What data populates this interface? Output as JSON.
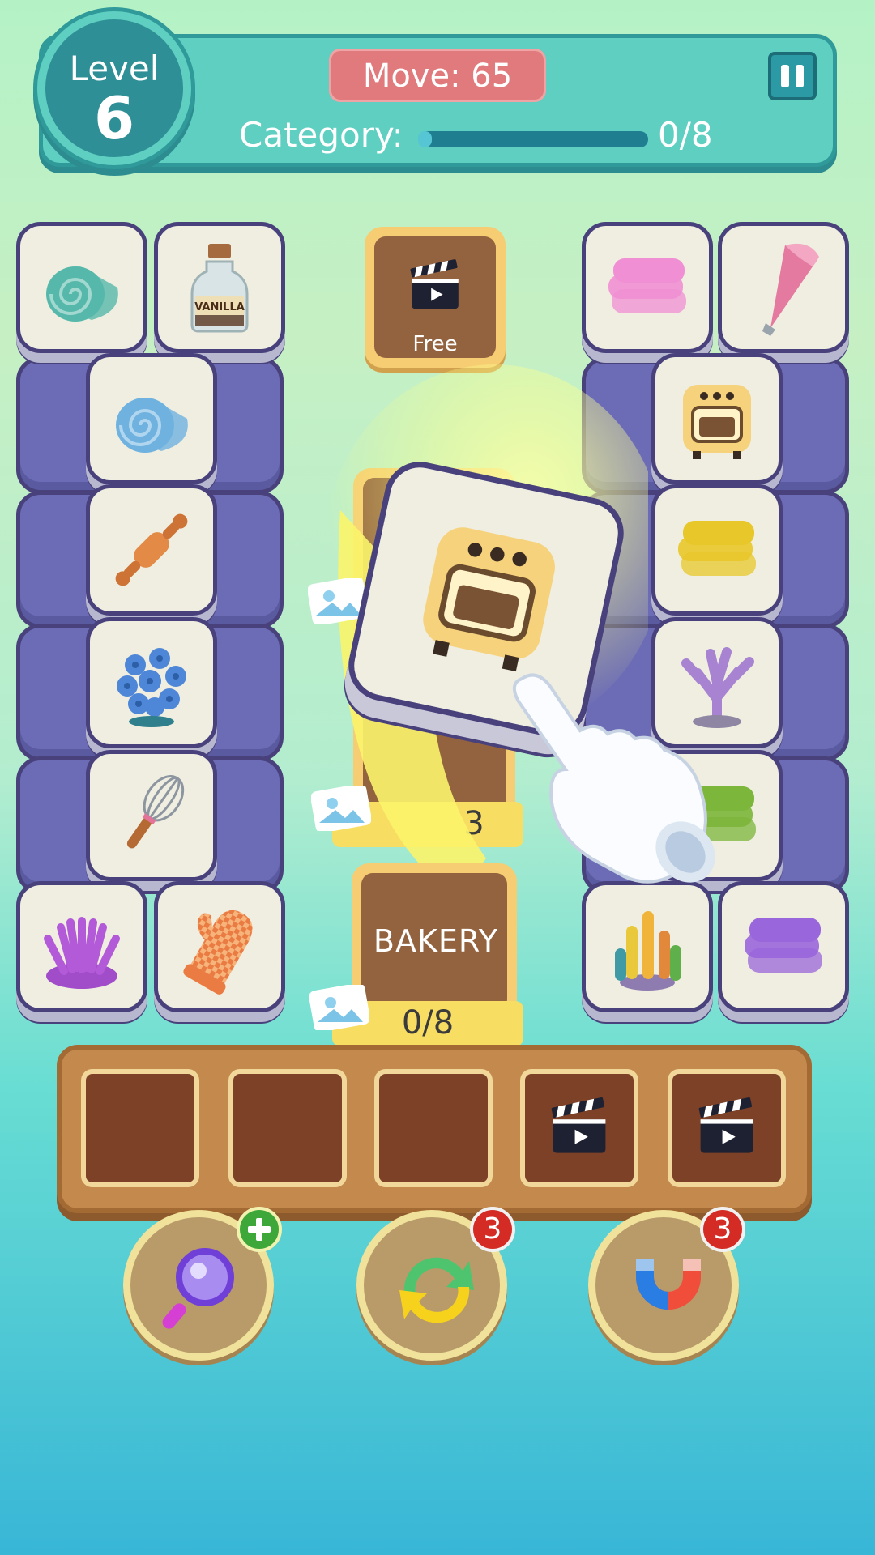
{
  "header": {
    "level_label": "Level",
    "level_number": "6",
    "move_text": "Move: 65",
    "category_label": "Category:",
    "category_progress": 0,
    "category_count": "0/8",
    "pause_icon": "pause-icon"
  },
  "board": {
    "left_tiles": [
      "teal-fondant-roll",
      "vanilla-bottle",
      "blue-fondant-roll",
      "rolling-pin",
      "blue-coral",
      "whisk",
      "purple-anemone",
      "oven-mitt"
    ],
    "right_tiles": [
      "pink-towel",
      "piping-bag",
      "small-oven",
      "yellow-towel",
      "purple-coral",
      "green-towel",
      "colorful-coral",
      "purple-towel"
    ],
    "vanilla_label": "VANILLA"
  },
  "center": {
    "free_label": "Free",
    "hidden_count_partial": "3",
    "bakery_label": "BAKERY",
    "bakery_count": "0/8",
    "highlight_tile": "oven"
  },
  "tray": {
    "slots": [
      "empty",
      "empty",
      "empty",
      "video-clapper",
      "video-clapper"
    ]
  },
  "powerups": [
    {
      "name": "magnifier",
      "badge": "+",
      "icon": "magnifier-icon"
    },
    {
      "name": "shuffle",
      "badge": "3",
      "icon": "shuffle-icon"
    },
    {
      "name": "magnet",
      "badge": "3",
      "icon": "magnet-icon"
    }
  ],
  "colors": {
    "accent": "#5ecfc0",
    "tile": "#efeee0",
    "tray": "#c4894d",
    "stack": "#6c6cb6"
  }
}
